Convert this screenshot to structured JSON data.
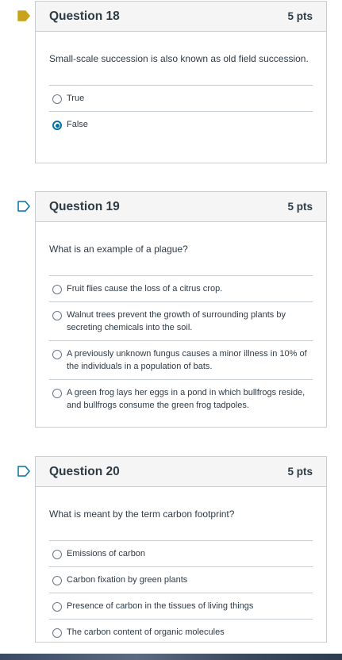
{
  "questions": [
    {
      "title": "Question 18",
      "points": "5 pts",
      "text": "Small-scale succession is also known as old field succession.",
      "flagged": true,
      "answers": [
        {
          "label": "True",
          "selected": false
        },
        {
          "label": "False",
          "selected": true
        }
      ]
    },
    {
      "title": "Question 19",
      "points": "5 pts",
      "text": "What is an example of a plague?",
      "flagged": false,
      "answers": [
        {
          "label": "Fruit flies cause the loss of a citrus crop.",
          "selected": false
        },
        {
          "label": "Walnut trees prevent the growth of surrounding plants by secreting chemicals into the soil.",
          "selected": false
        },
        {
          "label": "A previously unknown fungus causes a minor illness in 10% of the individuals in a population of bats.",
          "selected": false
        },
        {
          "label": "A green frog lays her eggs in a pond in which bullfrogs reside, and bullfrogs consume the green frog tadpoles.",
          "selected": false
        }
      ]
    },
    {
      "title": "Question 20",
      "points": "5 pts",
      "text": "What is meant by the term carbon footprint?",
      "flagged": false,
      "answers": [
        {
          "label": "Emissions of carbon",
          "selected": false
        },
        {
          "label": "Carbon fixation by green plants",
          "selected": false
        },
        {
          "label": "Presence of carbon in the tissues of living things",
          "selected": false
        },
        {
          "label": "The carbon content of organic molecules",
          "selected": false
        }
      ]
    }
  ],
  "colors": {
    "flag_filled": "#c8a31b",
    "flag_outline": "#0770a3",
    "radio_selected": "#0770a3",
    "border": "#c7cdd1",
    "header_bg": "#f5f5f5"
  },
  "icons": {
    "flag": "bookmark-flag-icon",
    "radio": "radio-button-icon"
  }
}
